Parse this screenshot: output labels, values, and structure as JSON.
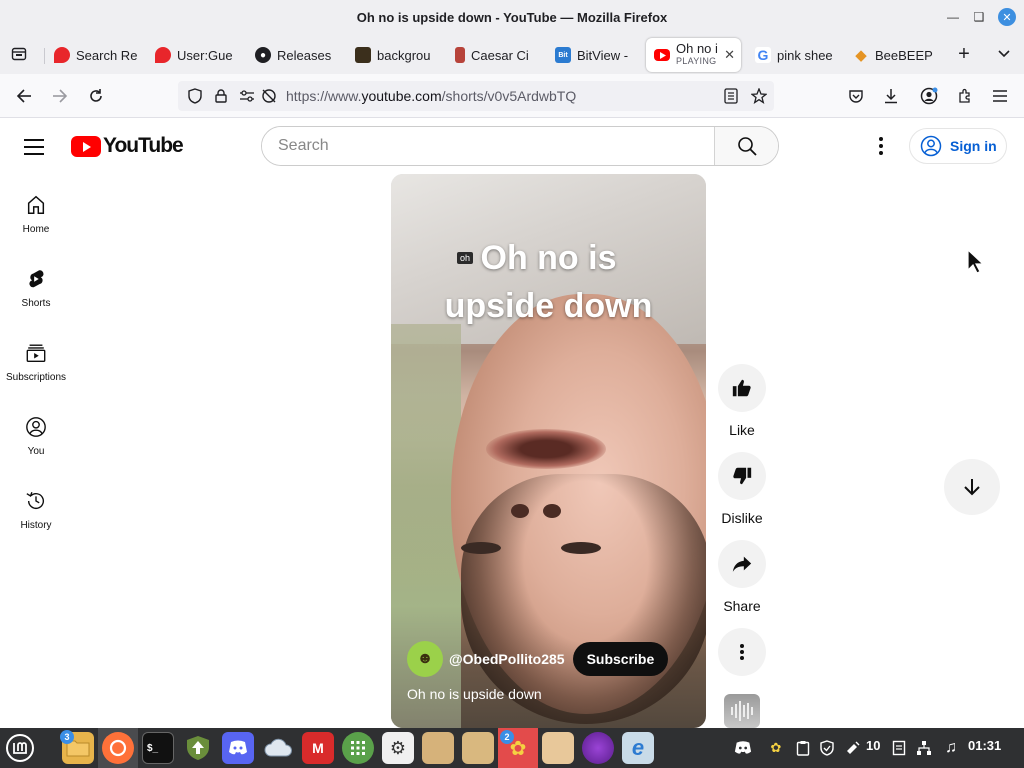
{
  "window": {
    "title": "Oh no is upside down - YouTube — Mozilla Firefox"
  },
  "tabs": [
    {
      "label": "Search Re",
      "icon": "fire-icon",
      "color": "#e8262b"
    },
    {
      "label": "User:Gue",
      "icon": "fire-icon",
      "color": "#e8262b"
    },
    {
      "label": "Releases",
      "icon": "github-icon",
      "color": "#1f1f23"
    },
    {
      "label": "backgrou",
      "icon": "image-icon",
      "color": "#3b2f1c"
    },
    {
      "label": "Caesar Ci",
      "icon": "cipher-icon",
      "color": "#b7433a"
    },
    {
      "label": "BitView -",
      "icon": "bitview-icon",
      "color": "#2b7bd1"
    },
    {
      "label": "Oh no i",
      "sublabel": "PLAYING",
      "icon": "youtube-icon",
      "color": "#ff0000",
      "active": true
    },
    {
      "label": "pink shee",
      "icon": "google-icon",
      "color": "#4285f4"
    },
    {
      "label": "BeeBEEP",
      "icon": "diamond-icon",
      "color": "#e59424"
    }
  ],
  "navbar": {
    "url_prefix": "https://www.",
    "url_domain": "youtube.com",
    "url_path": "/shorts/v0v5ArdwbTQ"
  },
  "youtube": {
    "logo_text": "YouTube",
    "search_placeholder": "Search",
    "sign_in": "Sign in",
    "guide": [
      {
        "label": "Home",
        "icon": "home-icon"
      },
      {
        "label": "Shorts",
        "icon": "shorts-icon"
      },
      {
        "label": "Subscriptions",
        "icon": "subscriptions-icon"
      },
      {
        "label": "You",
        "icon": "you-icon"
      },
      {
        "label": "History",
        "icon": "history-icon"
      }
    ],
    "short": {
      "overlay_line1": "Oh no is",
      "overlay_line2": "upside down",
      "tag": "oh",
      "channel_handle": "@ObedPollito285",
      "subscribe": "Subscribe",
      "title": "Oh no is upside down"
    },
    "actions": {
      "like": "Like",
      "dislike": "Dislike",
      "share": "Share"
    }
  },
  "taskbar": {
    "files_badge": "3",
    "bee_badge": "2",
    "tray_count": "10",
    "clock": "01:31"
  },
  "colors": {
    "youtube_red": "#ff0000",
    "link_blue": "#065fd4",
    "taskbar_bg": "#2f3032"
  }
}
